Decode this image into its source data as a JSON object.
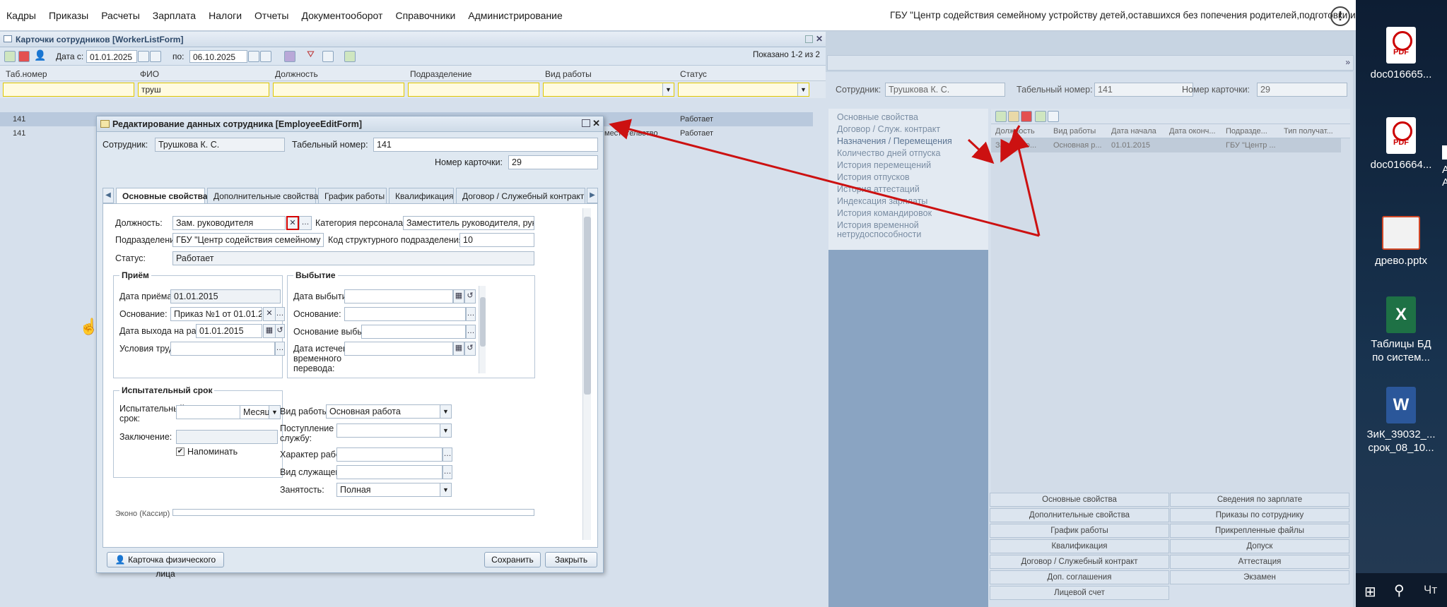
{
  "menu": [
    "Кадры",
    "Приказы",
    "Расчеты",
    "Зарплата",
    "Налоги",
    "Отчеты",
    "Документооборот",
    "Справочники",
    "Администрирование"
  ],
  "org_name": "ГБУ \"Центр содействия семейному устройству детей,оставшихся без попечения родителей,подготовки и соп",
  "info_icon": "!",
  "list_window": {
    "title": "Карточки сотрудников [WorkerListForm]",
    "date_from_label": "Дата с:",
    "date_from": "01.01.2025",
    "date_to_label": "по:",
    "date_to": "06.10.2025",
    "shown": "Показано 1-2 из 2",
    "columns": [
      "Таб.номер",
      "ФИО",
      "Должность",
      "Подразделение",
      "Вид работы",
      "Статус"
    ],
    "filter_fio": "труш",
    "rows": [
      {
        "tab": "141",
        "status": "Работает"
      },
      {
        "tab": "141",
        "extra": "местительство",
        "status": "Работает"
      }
    ]
  },
  "dialog": {
    "title": "Редактирование данных сотрудника [EmployeeEditForm]",
    "employee_label": "Сотрудник:",
    "employee": "Трушкова К. С.",
    "tabnum_label": "Табельный номер:",
    "tabnum": "141",
    "card_label": "Номер карточки:",
    "card": "29",
    "tabs": [
      "Основные свойства",
      "Дополнительные свойства",
      "График работы",
      "Квалификация",
      "Договор / Служебный контракт"
    ],
    "position_label": "Должность:",
    "position": "Зам. руководителя",
    "category_label": "Категория персонала:",
    "category": "Заместитель руководителя, руко",
    "dept_label": "Подразделение:",
    "dept": "ГБУ \"Центр содействия семейному ус",
    "dept_code_label": "Код структурного подразделения:",
    "dept_code": "10",
    "status_label": "Статус:",
    "status": "Работает",
    "hire_group": "Приём",
    "hire_date_label": "Дата приёма:",
    "hire_date": "01.01.2015",
    "basis_label": "Основание:",
    "basis": "Приказ №1 от 01.01.2015",
    "start_date_label": "Дата выхода на работу:",
    "start_date": "01.01.2015",
    "conditions_label": "Условия труда:",
    "leave_group": "Выбытие",
    "leave_date_label": "Дата выбытия:",
    "leave_basis_label": "Основание:",
    "leave_reason_label": "Основание выбытия:",
    "temp_end_label_1": "Дата истечения",
    "temp_end_label_2": "временного",
    "temp_end_label_3": "перевода:",
    "probation_group": "Испытательный срок",
    "probation_label_1": "Испытательный",
    "probation_label_2": "срок:",
    "probation_unit": "Месяц",
    "conclusion_label": "Заключение:",
    "remind_label": "Напоминать",
    "work_type_label": "Вид работы:",
    "work_type": "Основная работа",
    "service_label_1": "Поступление на",
    "service_label_2": "службу:",
    "work_nature_label": "Характер работ:",
    "employee_kind_label": "Вид служащего:",
    "employment_label": "Занятость:",
    "employment": "Полная",
    "cut_label": "Эконо (Кассир)",
    "person_card_button": "Карточка физического лица",
    "save_button": "Сохранить",
    "close_button": "Закрыть"
  },
  "right": {
    "employee_label": "Сотрудник:",
    "employee": "Трушкова К. С.",
    "tabnum_label": "Табельный номер:",
    "tabnum": "141",
    "card_label": "Номер карточки:",
    "card": "29",
    "nav": [
      "Основные свойства",
      "Договор / Служ. контракт",
      "Назначения / Перемещения",
      "Количество дней отпуска",
      "История перемещений",
      "История отпусков",
      "История аттестаций",
      "Индексация зарплаты",
      "История командировок",
      "История временной",
      "нетрудоспособности"
    ],
    "columns": [
      "Должность",
      "Вид работы",
      "Дата начала",
      "Дата оконч...",
      "Подразде...",
      "Тип получат..."
    ],
    "row": [
      "Зам. руко...",
      "Основная р...",
      "01.01.2015",
      "",
      "ГБУ \"Центр ..."
    ],
    "buttons_left": [
      "Основные свойства",
      "Дополнительные свойства",
      "График работы",
      "Квалификация",
      "Договор / Служебный контракт",
      "Доп. соглашения",
      "Лицевой счет"
    ],
    "buttons_right": [
      "Сведения по зарплате",
      "Приказы по сотруднику",
      "Прикрепленные файлы",
      "Допуск",
      "Аттестация",
      "Экзамен"
    ]
  },
  "desktop": [
    {
      "label1": "doc016665...",
      "icon": "pdf-icon"
    },
    {
      "label1": "doc016664...",
      "icon": "pdf-icon"
    },
    {
      "label1": "древо.pptx",
      "icon": "pptx-icon"
    },
    {
      "label1": "Таблицы БД",
      "label2": "по систем...",
      "icon": "xlsx-icon"
    },
    {
      "label1": "ЗиК_39032_...",
      "label2": "срок_08_10...",
      "icon": "docx-icon"
    }
  ],
  "desktop_partial": [
    "A",
    "A"
  ],
  "taskbar_search": "Чт",
  "colors": {
    "arrow": "#cc1111",
    "highlight": "#d40000"
  }
}
